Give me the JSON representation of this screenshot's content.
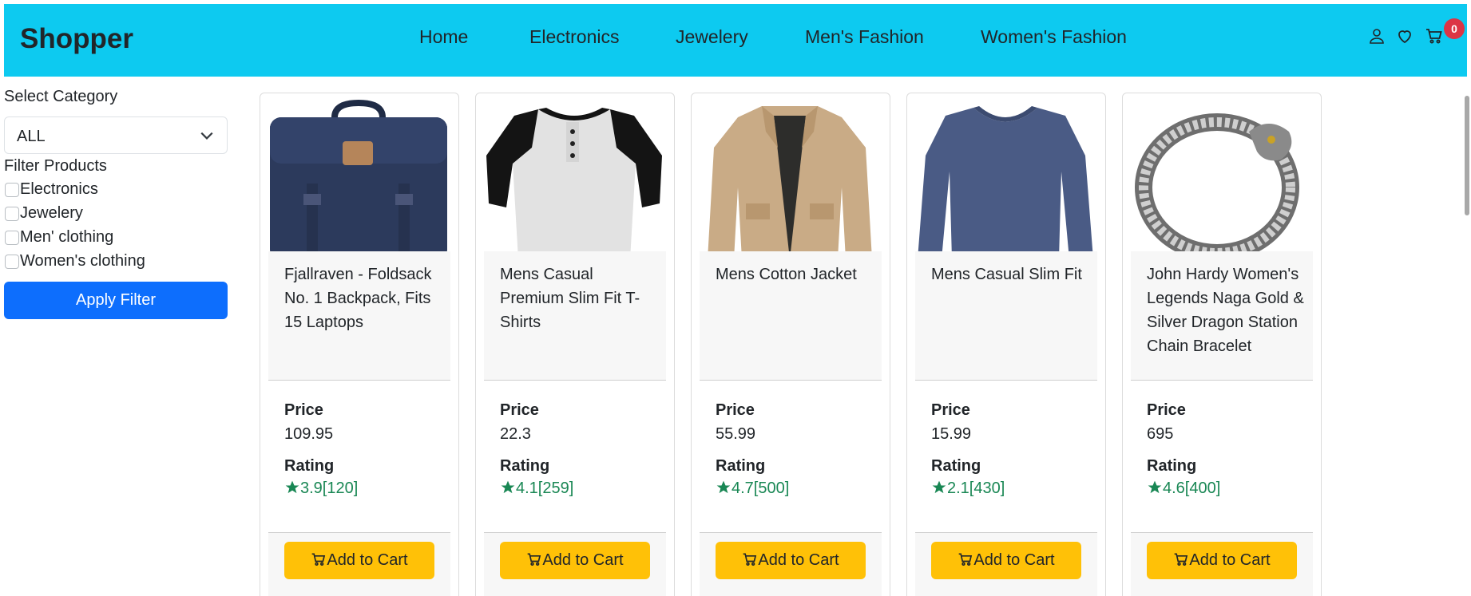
{
  "header": {
    "brand": "Shopper",
    "nav": [
      "Home",
      "Electronics",
      "Jewelery",
      "Men's Fashion",
      "Women's Fashion"
    ],
    "cart_count": "0",
    "icons": [
      "user-icon",
      "heart-icon",
      "cart-icon"
    ]
  },
  "sidebar": {
    "select_label": "Select Category",
    "select_value": "ALL",
    "filter_label": "Filter Products",
    "filters": [
      "Electronics",
      "Jewelery",
      "Men' clothing",
      "Women's clothing"
    ],
    "apply_label": "Apply Filter"
  },
  "colors": {
    "header_bg": "#0dcaf0",
    "apply_btn": "#0d6efd",
    "cart_btn": "#ffc107",
    "rating": "#198754",
    "badge": "#dc3545"
  },
  "products": [
    {
      "title": "Fjallraven - Foldsack No. 1 Backpack, Fits 15 Laptops",
      "price_label": "Price",
      "price": "109.95",
      "rating_label": "Rating",
      "rating": "3.9[120]",
      "button": "Add to Cart"
    },
    {
      "title": "Mens Casual Premium Slim Fit T-Shirts",
      "price_label": "Price",
      "price": "22.3",
      "rating_label": "Rating",
      "rating": "4.1[259]",
      "button": "Add to Cart"
    },
    {
      "title": "Mens Cotton Jacket",
      "price_label": "Price",
      "price": "55.99",
      "rating_label": "Rating",
      "rating": "4.7[500]",
      "button": "Add to Cart"
    },
    {
      "title": "Mens Casual Slim Fit",
      "price_label": "Price",
      "price": "15.99",
      "rating_label": "Rating",
      "rating": "2.1[430]",
      "button": "Add to Cart"
    },
    {
      "title": "John Hardy Women's Legends Naga Gold & Silver Dragon Station Chain Bracelet",
      "price_label": "Price",
      "price": "695",
      "rating_label": "Rating",
      "rating": "4.6[400]",
      "button": "Add to Cart"
    }
  ]
}
